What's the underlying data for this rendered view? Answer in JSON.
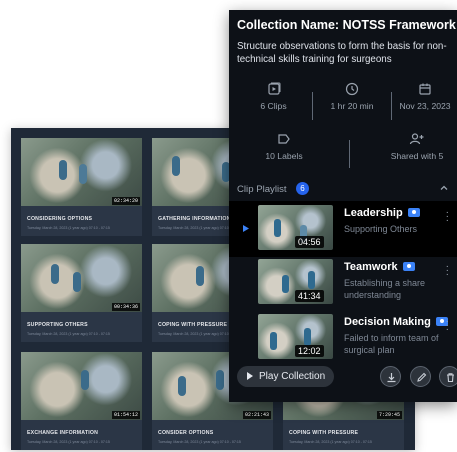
{
  "grid": {
    "cards": [
      {
        "title": "CONSIDERING OPTIONS",
        "subtitle": "Tuesday, March 28, 2023 (1 year ago) 07:10 - 07:15",
        "duration": "02:34:20"
      },
      {
        "title": "GATHERING INFORMATION",
        "subtitle": "Tuesday, March 28, 2023 (1 year ago) 07:10 - 07:15",
        "duration": ""
      },
      {
        "title": "SUPPORTING OTHERS",
        "subtitle": "Tuesday, March 28, 2023 (1 year ago) 07:10 - 07:15",
        "duration": "00:34:36"
      },
      {
        "title": "COPING WITH PRESSURE",
        "subtitle": "Tuesday, March 28, 2023 (1 year ago) 07:10 - 07:15",
        "duration": ""
      },
      {
        "title": "EXCHANGE INFORMATION",
        "subtitle": "Tuesday, March 28, 2023 (1 year ago) 07:10 - 07:15",
        "duration": "01:54:12"
      },
      {
        "title": "CONSIDER OPTIONS",
        "subtitle": "Tuesday, March 28, 2023 (1 year ago) 07:10 - 07:15",
        "duration": "02:21:43"
      },
      {
        "title": "COPING WITH PRESSURE",
        "subtitle": "Tuesday, March 28, 2023 (1 year ago) 07:10 - 07:15",
        "duration": "7:29:45"
      }
    ]
  },
  "collection": {
    "title": "Collection Name: NOTSS Framework",
    "description": "Structure observations to form the basis for non-technical skills training for surgeons",
    "stats": {
      "clips": "6 Clips",
      "duration": "1 hr 20 min",
      "date": "Nov 23, 2023",
      "labels": "10 Labels",
      "shared": "Shared with 5"
    },
    "playlist": {
      "label": "Clip Playlist",
      "count": "6",
      "items": [
        {
          "title": "Leadership",
          "subtitle": "Supporting Others",
          "duration": "04:56"
        },
        {
          "title": "Teamwork",
          "subtitle": "Establishing a share understanding",
          "duration": "41:34"
        },
        {
          "title": "Decision Making",
          "subtitle": "Failed to inform team of surgical plan",
          "duration": "12:02"
        }
      ]
    },
    "play_button": "Play Collection"
  },
  "icons": [
    "clips-icon",
    "clock-icon",
    "calendar-icon",
    "label-icon",
    "add-user-icon",
    "chevron-up-icon",
    "play-icon",
    "more-icon",
    "download-icon",
    "edit-icon",
    "delete-icon",
    "person-badge-icon"
  ],
  "colors": {
    "panel_bg": "#0d1117",
    "grid_bg": "#1f2937",
    "accent": "#2563eb",
    "badge": "#3b82f6"
  }
}
